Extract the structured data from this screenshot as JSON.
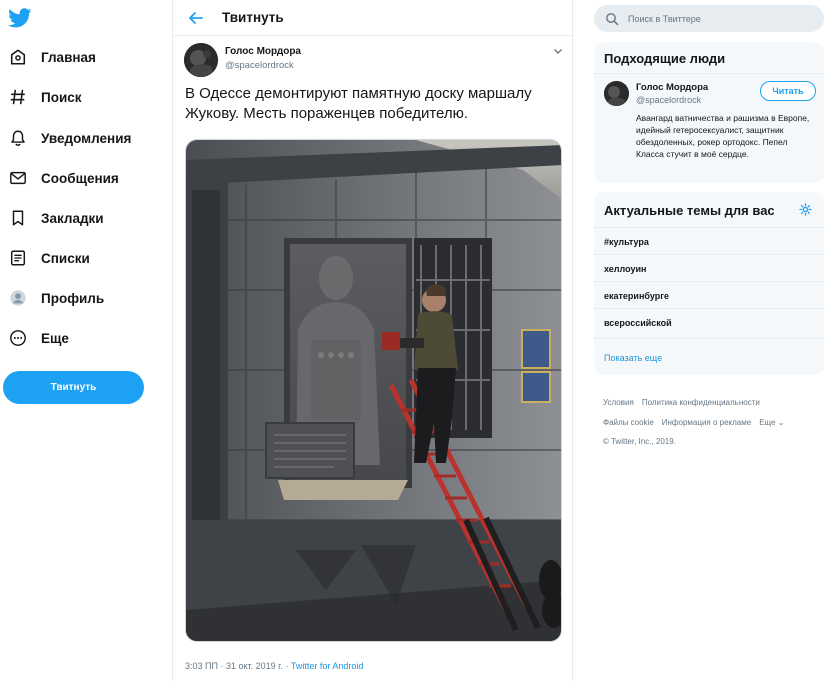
{
  "nav": {
    "logo_icon": "twitter-bird-icon",
    "items": [
      {
        "label": "Главная",
        "icon": "home-icon"
      },
      {
        "label": "Поиск",
        "icon": "hashtag-icon"
      },
      {
        "label": "Уведомления",
        "icon": "bell-icon"
      },
      {
        "label": "Сообщения",
        "icon": "envelope-icon"
      },
      {
        "label": "Закладки",
        "icon": "bookmark-icon"
      },
      {
        "label": "Списки",
        "icon": "list-icon"
      },
      {
        "label": "Профиль",
        "icon": "avatar-icon"
      },
      {
        "label": "Еще",
        "icon": "more-icon"
      }
    ],
    "tweet_button": "Твитнуть"
  },
  "center": {
    "title": "Твитнуть",
    "tweet": {
      "name": "Голос Мордора",
      "handle": "@spacelordrock",
      "text": "В Одессе демонтируют памятную доску маршалу Жукову. Месть пораженцев победителю.",
      "time": "3:03 ПП · 31 окт. 2019 г. · ",
      "source": "Twitter for Android"
    }
  },
  "right": {
    "search_placeholder": "Поиск в Твиттере",
    "people": {
      "title": "Подходящие люди",
      "name": "Голос Мордора",
      "handle": "@spacelordrock",
      "follow": "Читать",
      "bio": "Авангард ватничества и рашизма в Европе, идейный гетеросексуалист, защитник обездоленных, рокер ортодокс. Пепел Класса стучит в моё сердце."
    },
    "trends": {
      "title": "Актуальные темы для вас",
      "items": [
        "#культура",
        "хеллоуин",
        "екатеринбурге",
        "всероссийской"
      ],
      "show_more": "Показать еще"
    },
    "footer": {
      "line1": [
        "Условия",
        "Политика конфиденциальности"
      ],
      "line2": [
        "Файлы cookie",
        "Информация о рекламе",
        "Еще ⌄"
      ],
      "copyright": "© Twitter, Inc., 2019."
    }
  },
  "colors": {
    "accent": "#1da1f2",
    "text": "#14171a",
    "secondary": "#657786",
    "panel": "#f5f8fa",
    "border": "#e6ecf0"
  }
}
